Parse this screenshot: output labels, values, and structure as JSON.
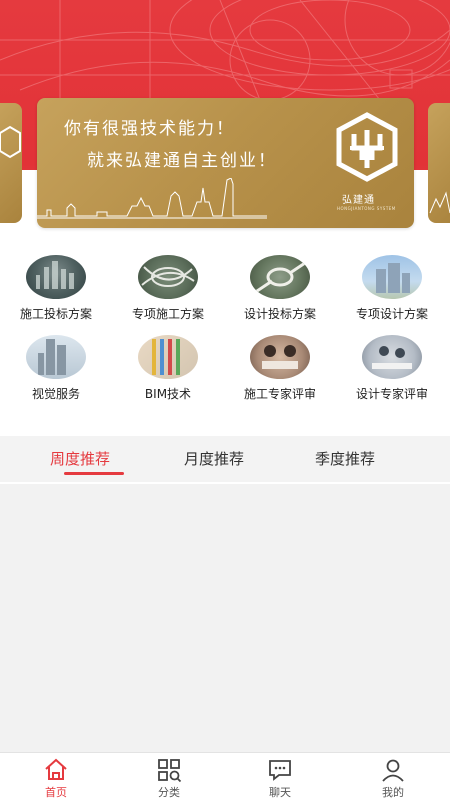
{
  "banner": {
    "line1": "你有很强技术能力！",
    "line2": "就来弘建通自主创业！",
    "brand": "弘建通",
    "brand_en": "HONGJIANTONG SYSTEM"
  },
  "categories": [
    {
      "label": "施工投标方案",
      "icon": "city-aerial-photo"
    },
    {
      "label": "专项施工方案",
      "icon": "interchange-photo"
    },
    {
      "label": "设计投标方案",
      "icon": "roundabout-photo"
    },
    {
      "label": "专项设计方案",
      "icon": "buildings-photo"
    },
    {
      "label": "视觉服务",
      "icon": "skyscraper-photo"
    },
    {
      "label": "BIM技术",
      "icon": "pipes-photo"
    },
    {
      "label": "施工专家评审",
      "icon": "meeting-photo"
    },
    {
      "label": "设计专家评审",
      "icon": "office-photo"
    }
  ],
  "tabs": [
    {
      "label": "周度推荐",
      "active": true
    },
    {
      "label": "月度推荐",
      "active": false
    },
    {
      "label": "季度推荐",
      "active": false
    }
  ],
  "nav": [
    {
      "label": "首页",
      "icon": "home-icon",
      "active": true
    },
    {
      "label": "分类",
      "icon": "grid-search-icon",
      "active": false
    },
    {
      "label": "聊天",
      "icon": "chat-icon",
      "active": false
    },
    {
      "label": "我的",
      "icon": "user-icon",
      "active": false
    }
  ],
  "colors": {
    "accent": "#e53a3f",
    "banner_gold": "#b8924b",
    "tab_bg": "#f3f3f3"
  }
}
